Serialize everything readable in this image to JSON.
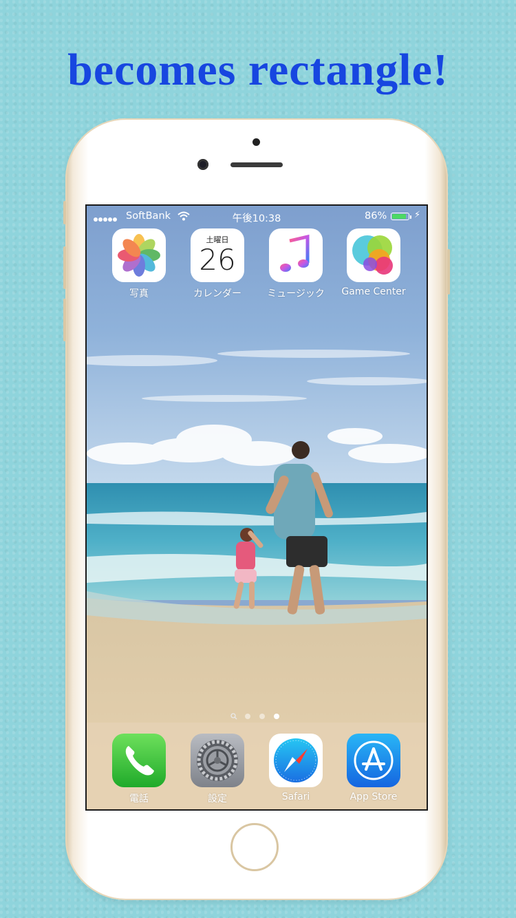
{
  "headline": "becomes rectangle!",
  "status_bar": {
    "carrier": "SoftBank",
    "time": "午後10:38",
    "battery_percent": "86%",
    "battery_level": 0.86
  },
  "home_apps": [
    {
      "label": "写真",
      "icon": "photos-icon"
    },
    {
      "label": "カレンダー",
      "icon": "calendar-icon",
      "weekday": "土曜日",
      "day": "26"
    },
    {
      "label": "ミュージック",
      "icon": "music-icon"
    },
    {
      "label": "Game Center",
      "icon": "game-center-icon"
    }
  ],
  "page_indicator": {
    "pages": 3,
    "current": 3,
    "has_search_page": true
  },
  "dock_apps": [
    {
      "label": "電話",
      "icon": "phone-icon"
    },
    {
      "label": "設定",
      "icon": "settings-icon"
    },
    {
      "label": "Safari",
      "icon": "safari-icon"
    },
    {
      "label": "App Store",
      "icon": "app-store-icon"
    }
  ],
  "colors": {
    "background": "#8fd4dc",
    "headline": "#1746e0",
    "phone_frame": "#ffffff",
    "battery": "#4cd964"
  }
}
